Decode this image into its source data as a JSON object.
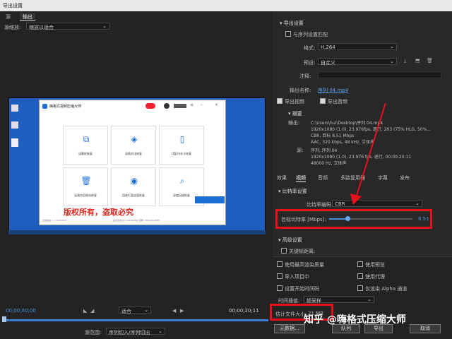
{
  "window": {
    "title": "导出设置"
  },
  "left": {
    "tabs": [
      "源",
      "输出"
    ],
    "scale_label": "源缩放:",
    "scale_value": "缩放以适合",
    "time_start": "00;00;00;00",
    "time_end": "00;00;20;11",
    "fit": "适合",
    "source_range_label": "源范围:",
    "source_range_value": "序列切入/序列切出",
    "app": {
      "title": "嗨格式视频压缩大师",
      "cards": [
        "误删除恢复",
        "误格式化恢复",
        "U盘/内存卡恢复",
        "误清空回收站恢复",
        "回收/C盘全面恢复",
        "深度扫描恢复"
      ],
      "watermark": "版权所有，盗取必究",
      "footer_left": "当前版本: 1.3.1415.403",
      "footer_mid": "技术支持QQ: 123456789  官网: 400-020-0588"
    },
    "desktop_icons": [
      "",
      "",
      ""
    ]
  },
  "export": {
    "section_title": "导出设置",
    "match_seq": "与序列设置匹配",
    "format_label": "格式:",
    "format_value": "H.264",
    "preset_label": "预设:",
    "preset_value": "自定义",
    "comment_label": "注释:",
    "output_label": "输出名称:",
    "output_value": "序列 04.mp4",
    "export_video": "导出视频",
    "export_audio": "导出音频",
    "summary_title": "摘要",
    "out_label": "输出:",
    "out_path": "C:\\Users\\hui\\Desktop\\序列 04.mp4",
    "out_line2": "1920x1080 (1.0), 23.976fps, 逐行, 203 (75% HLG, 50%...",
    "out_line3": "CBR, 目标 8.51 Mbps",
    "out_line4": "AAC, 320 kbps, 48 kHz, 立体声",
    "src_label": "源:",
    "src_line1": "序列, 序列 04",
    "src_line2": "1920x1080 (1.0), 23.976 fps, 逐行, 00;00;20;11",
    "src_line3": "48000 Hz, 立体声"
  },
  "tabs2": [
    "效果",
    "视频",
    "音频",
    "多路复用器",
    "字幕",
    "发布"
  ],
  "bitrate": {
    "section": "比特率设置",
    "encoding_label": "比特率编码:",
    "encoding_value": "CBR",
    "target_label": "目标比特率 [Mbps]:",
    "target_value": "8.51",
    "target_fraction": 0.22
  },
  "advanced": {
    "section": "高级设置",
    "keyframe": "关键帧距离:"
  },
  "options": {
    "max_quality": "使用最高渲染质量",
    "use_preview": "使用预览",
    "import_project": "导入项目中",
    "use_proxy": "使用代理",
    "set_timecode": "设置开始时间码",
    "alpha_only": "仅渲染 Alpha 通道",
    "interp_label": "时间插值:",
    "interp_value": "帧采样",
    "filesize_label": "估计文件大小:",
    "filesize_value": "21 MB"
  },
  "buttons": {
    "metadata": "元数据...",
    "queue": "队列",
    "export": "导出",
    "cancel": "取消"
  },
  "watermark_text": "知乎 @嗨格式压缩大师"
}
